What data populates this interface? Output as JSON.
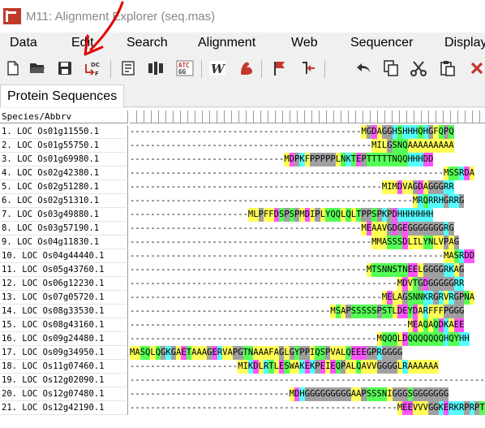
{
  "window": {
    "title": "M11: Alignment Explorer (seq.mas)"
  },
  "menu": [
    "Data",
    "Edit",
    "Search",
    "Alignment",
    "Web",
    "Sequencer",
    "Display"
  ],
  "toolbar": {
    "buttons": [
      "new-icon",
      "open-icon",
      "save-icon",
      "close-data-icon",
      "edit-icon",
      "align-icon",
      "translate-icon",
      "w-icon",
      "muscle-icon",
      "flag-icon",
      "insert-gap-icon",
      "undo-icon",
      "copy-icon",
      "cut-icon",
      "paste-icon",
      "delete-icon"
    ]
  },
  "tab": {
    "label": "Protein Sequences"
  },
  "grid": {
    "header_label": "Species/Abbrv",
    "rows": [
      {
        "name": "1. LOC Os01g11550.1",
        "seq": "---------------------------------------------MGDAGGHSHHHQHGFQPQ"
      },
      {
        "name": "2. LOC Os01g55750.1",
        "seq": "-----------------------------------------------MILGSNQAAAAAAAAA"
      },
      {
        "name": "3. LOC Os01g69980.1",
        "seq": "------------------------------MDPKFPPPPPLNKTEPTTTTTNQQHHHDD"
      },
      {
        "name": "4. LOC Os02g42380.1",
        "seq": "-------------------------------------------------------------MSSRDA"
      },
      {
        "name": "5. LOC Os02g51280.1",
        "seq": "-------------------------------------------------MIMDVAGDAGGGRR"
      },
      {
        "name": "6. LOC Os02g51310.1",
        "seq": "-------------------------------------------------------MRQRRHGRRG"
      },
      {
        "name": "7. LOC Os03g49880.1",
        "seq": "-----------------------MLPFFDSPSPMDIPLYQQLQLTPPSPKPDHHHHHHH"
      },
      {
        "name": "8. LOC Os03g57190.1",
        "seq": "---------------------------------------------MEAAVGDGEGGGGGGGRG"
      },
      {
        "name": "9. LOC Os04g11830.1",
        "seq": "-----------------------------------------------MMASSSDLILYNLVPAG"
      },
      {
        "name": "10. LOC Os04g44440.1",
        "seq": "-------------------------------------------------------------MASRDD"
      },
      {
        "name": "11. LOC Os05g43760.1",
        "seq": "----------------------------------------------MTSNNSTNEELGGGGRKAG"
      },
      {
        "name": "12. LOC Os06g12230.1",
        "seq": "----------------------------------------------------MDVTGDGGGGGRR"
      },
      {
        "name": "13. LOC Os07g05720.1",
        "seq": "-------------------------------------------------MELAGSNNKRGRVRGPNA"
      },
      {
        "name": "14. LOC Os08g33530.1",
        "seq": "---------------------------------------MSAPSSSSSPSTLDEYDARFFFPGGG"
      },
      {
        "name": "15. LOC Os08g43160.1",
        "seq": "------------------------------------------------------MEAQAQDKAEE"
      },
      {
        "name": "16. LOC Os09g24480.1",
        "seq": "------------------------------------------------MQQQLDQQQQQQQHQYHH"
      },
      {
        "name": "17. LOC Os09g34950.1",
        "seq": "MASQLQGKGAETAAAGERVAPGTNAAAFAGLGYPPIQSPVALQEEEGPRGGGG"
      },
      {
        "name": "18. LOC Os11g07460.1",
        "seq": "---------------------MIKDLRTLESWAKEKPEIEQPALQAVVGGGGLRAAAAAA"
      },
      {
        "name": "19. LOC Os12g02090.1",
        "seq": "-----------------------------------------------------------------------"
      },
      {
        "name": "20. LOC Os12g07480.1",
        "seq": "-------------------------------MDHGGGGGGGGGAAPSSSNIGGGSGGGGGGG"
      },
      {
        "name": "21. LOC Os12g42190.1",
        "seq": "----------------------------------------------------MEEVVVGGKERKRPRPTE"
      }
    ]
  },
  "residue_colors": {
    "A": "#ffff55",
    "V": "#ffff55",
    "L": "#ffff55",
    "I": "#ffff55",
    "M": "#ffff55",
    "F": "#ffff55",
    "W": "#ffff55",
    "C": "#ffff55",
    "G": "#a0a0a0",
    "P": "#a0a0a0",
    "S": "#55ff55",
    "T": "#55ff55",
    "N": "#55ff55",
    "Q": "#55ff55",
    "Y": "#55ff55",
    "D": "#ff55ff",
    "E": "#ff55ff",
    "K": "#55ffff",
    "R": "#55ffff",
    "H": "#55ffff"
  }
}
